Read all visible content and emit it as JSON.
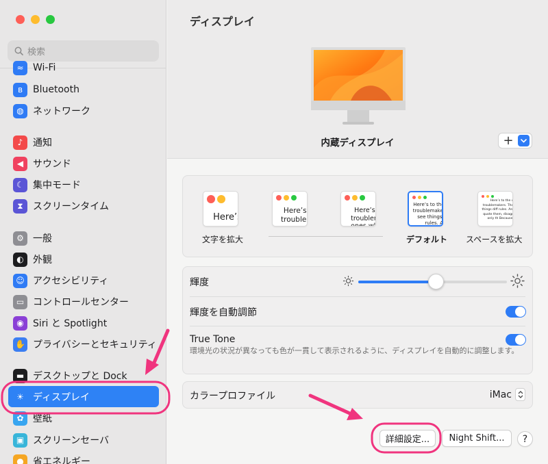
{
  "window": {
    "traffic_lights": [
      "close",
      "minimize",
      "zoom"
    ]
  },
  "sidebar": {
    "search_placeholder": "検索",
    "items": [
      {
        "label": "Wi-Fi",
        "icon": "wifi-icon",
        "color": "#2f7bf5"
      },
      {
        "label": "Bluetooth",
        "icon": "bluetooth-icon",
        "color": "#2f7bf5"
      },
      {
        "label": "ネットワーク",
        "icon": "globe-icon",
        "color": "#2f7bf5"
      },
      {
        "label": "通知",
        "icon": "bell-icon",
        "color": "#f34a4a"
      },
      {
        "label": "サウンド",
        "icon": "speaker-icon",
        "color": "#f0415f"
      },
      {
        "label": "集中モード",
        "icon": "moon-icon",
        "color": "#5b55d6"
      },
      {
        "label": "スクリーンタイム",
        "icon": "hourglass-icon",
        "color": "#5b55d6"
      },
      {
        "label": "一般",
        "icon": "gear-icon",
        "color": "#8e8e93"
      },
      {
        "label": "外観",
        "icon": "appearance-icon",
        "color": "#1d1d1f"
      },
      {
        "label": "アクセシビリティ",
        "icon": "accessibility-icon",
        "color": "#2f7bf5"
      },
      {
        "label": "コントロールセンター",
        "icon": "switches-icon",
        "color": "#8e8e93"
      },
      {
        "label": "Siri と Spotlight",
        "icon": "siri-icon",
        "color": "#8a3fd6"
      },
      {
        "label": "プライバシーとセキュリティ",
        "icon": "hand-icon",
        "color": "#3b7ef2"
      },
      {
        "label": "デスクトップと Dock",
        "icon": "dock-icon",
        "color": "#1d1d1f"
      },
      {
        "label": "ディスプレイ",
        "icon": "sun-icon",
        "color": "#2f7bf5"
      },
      {
        "label": "壁紙",
        "icon": "flower-icon",
        "color": "#38a5f0"
      },
      {
        "label": "スクリーンセーバ",
        "icon": "screensaver-icon",
        "color": "#38b5d9"
      },
      {
        "label": "省エネルギー",
        "icon": "bulb-icon",
        "color": "#f5a623"
      }
    ],
    "active_index": 14
  },
  "main": {
    "title": "ディスプレイ",
    "display_name": "内蔵ディスプレイ",
    "add_button_label": "+",
    "resolution": {
      "options": [
        {
          "label": "文字を拡大",
          "sample": "Here’s"
        },
        {
          "label": "",
          "sample": "Here’s to the troublemakers"
        },
        {
          "label": "",
          "sample": "Here’s to the troublemakers. ones who see t"
        },
        {
          "label": "デフォルト",
          "sample": "Here’s to the crazy ones. troublemakers. ones who see things differently. rules. And they"
        },
        {
          "label": "スペースを拡大",
          "sample": "Here’s to the crazy ones the troublemakers. The rou ones who see things diff rules. And they have no can quote them, disagre them. About the only th Because they change th"
        }
      ],
      "selected_index": 3
    },
    "brightness": {
      "label": "輝度",
      "value": 0.52
    },
    "auto_brightness": {
      "label": "輝度を自動調節",
      "on": true
    },
    "true_tone": {
      "label": "True Tone",
      "description": "環境光の状況が異なっても色が一貫して表示されるように、ディスプレイを自動的に調整します。",
      "on": true
    },
    "color_profile": {
      "label": "カラープロファイル",
      "value": "iMac"
    },
    "buttons": {
      "advanced": "詳細設定...",
      "night_shift": "Night Shift...",
      "help": "?"
    }
  },
  "annotations": {
    "color": "#f0347e"
  }
}
